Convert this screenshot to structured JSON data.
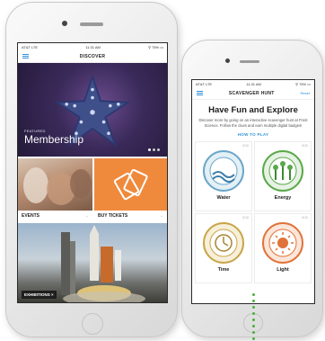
{
  "left_phone": {
    "status": {
      "carrier": "AT&T  LTE",
      "time": "11:31 AM",
      "battery": "⚲ 75% ▭"
    },
    "nav": {
      "title": "DISCOVER"
    },
    "hero": {
      "kicker": "FEATURED",
      "title": "Membership"
    },
    "tiles": [
      {
        "label": "EVENTS",
        "arrow": "→"
      },
      {
        "label": "BUY TICKETS",
        "arrow": "→"
      }
    ],
    "exhibitions_badge": "EXHIBITIONS  ×"
  },
  "right_phone": {
    "status": {
      "carrier": "AT&T  LTE",
      "time": "11:31 AM",
      "battery": "⚲ 75% ▭"
    },
    "nav": {
      "title": "SCAVENGER HUNT",
      "reset": "Reset"
    },
    "heading": "Have Fun and Explore",
    "description": "Discover more by going on an interactive scavenger hunt at Frost Science. Follow the clues and earn multiple digital badges!",
    "how_to_play": "HOW TO PLAY",
    "badges": [
      {
        "label": "Water",
        "meta": "0/10",
        "color": "#6ba6c8"
      },
      {
        "label": "Energy",
        "meta": "0/10",
        "color": "#5aa84a"
      },
      {
        "label": "Time",
        "meta": "0/10",
        "color": "#c9a54a"
      },
      {
        "label": "Light",
        "meta": "0/10",
        "color": "#e0733a"
      }
    ]
  },
  "colors": {
    "accent": "#2f8fd8",
    "tickets_orange": "#ef8a3d",
    "trail_green": "#4bb03c"
  }
}
